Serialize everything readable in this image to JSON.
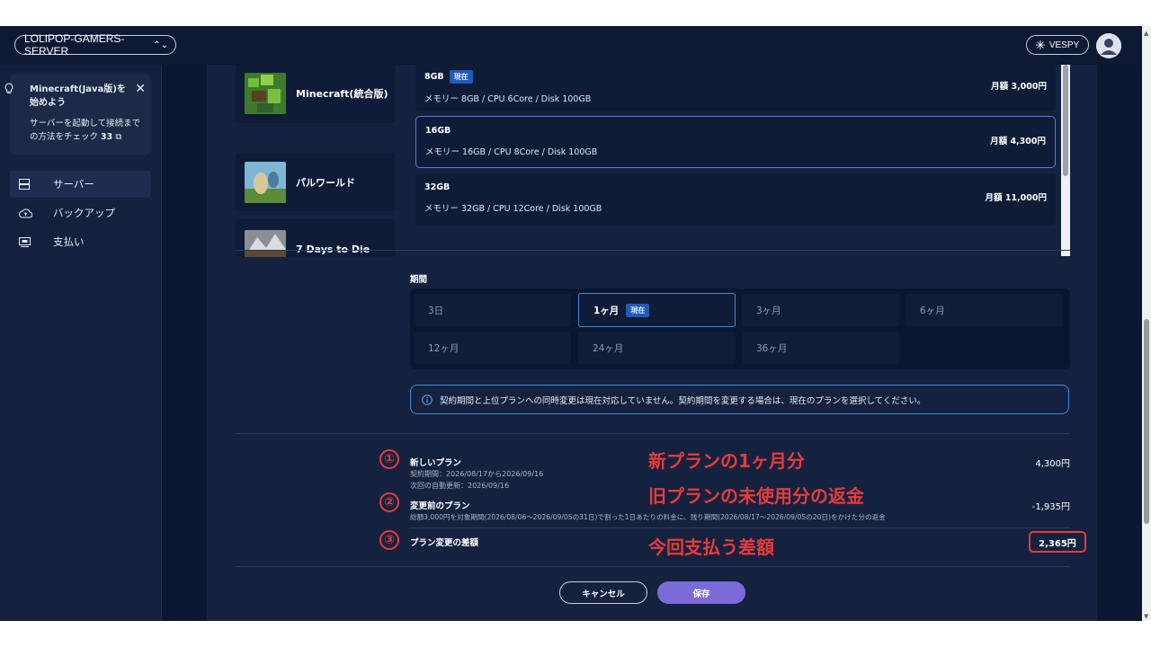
{
  "topbar": {
    "server_name": "LOLIPOP-GAMERS-SERVER",
    "user_label": "VESPY"
  },
  "sidebar": {
    "notice_title": "Minecraft(Java版)を始めよう",
    "notice_body_1": "サーバーを起動して接続まで",
    "notice_body_2": "の方法をチェック",
    "notice_link_suffix": "33",
    "items": [
      {
        "label": "サーバー",
        "icon": "server-icon"
      },
      {
        "label": "バックアップ",
        "icon": "cloud-upload-icon"
      },
      {
        "label": "支払い",
        "icon": "payment-icon"
      }
    ]
  },
  "games": [
    {
      "name": "Minecraft(統合版)"
    },
    {
      "name": "パルワールド"
    },
    {
      "name": "7 Days to Die"
    }
  ],
  "plans": [
    {
      "name": "8GB",
      "badge": "現在",
      "spec": "メモリー 8GB / CPU 6Core / Disk 100GB",
      "price": "月額 3,000円"
    },
    {
      "name": "16GB",
      "spec": "メモリー 16GB / CPU 8Core / Disk 100GB",
      "price": "月額 4,300円"
    },
    {
      "name": "32GB",
      "spec": "メモリー 32GB / CPU 12Core / Disk 100GB",
      "price": "月額 11,000円"
    }
  ],
  "period": {
    "label": "期間",
    "options": [
      {
        "label": "3日"
      },
      {
        "label": "1ヶ月",
        "badge": "現在"
      },
      {
        "label": "3ヶ月"
      },
      {
        "label": "6ヶ月"
      },
      {
        "label": "12ヶ月"
      },
      {
        "label": "24ヶ月"
      },
      {
        "label": "36ヶ月"
      }
    ],
    "info": "契約期間と上位プランへの同時変更は現在対応していません。契約期間を変更する場合は、現在のプランを選択してください。"
  },
  "summary": {
    "new_plan": {
      "title": "新しいプラン",
      "line1": "契約期間：2026/08/17から2026/09/16",
      "line2": "次回の自動更新：2026/09/16",
      "amount": "4,300円"
    },
    "old_plan": {
      "title": "変更前のプラン",
      "line1": "総額3,000円を対象期間(2026/08/06～2026/09/05の31日)で割った1日あたりの料金に、残り期間(2026/08/17～2026/09/05の20日)をかけた分の返金",
      "amount": "-1,935円"
    },
    "diff": {
      "title": "プラン変更の差額",
      "amount": "2,365円"
    }
  },
  "annotations": {
    "n1": "①",
    "n2": "②",
    "n3": "③",
    "a1": "新プランの1ヶ月分",
    "a2": "旧プランの未使用分の返金",
    "a3": "今回支払う差額"
  },
  "buttons": {
    "cancel": "キャンセル",
    "save": "保存"
  },
  "colors": {
    "accent": "#7b6ad8",
    "info_border": "#3e89d9",
    "annotation": "#e63b3b",
    "background": "#0e1a33"
  }
}
